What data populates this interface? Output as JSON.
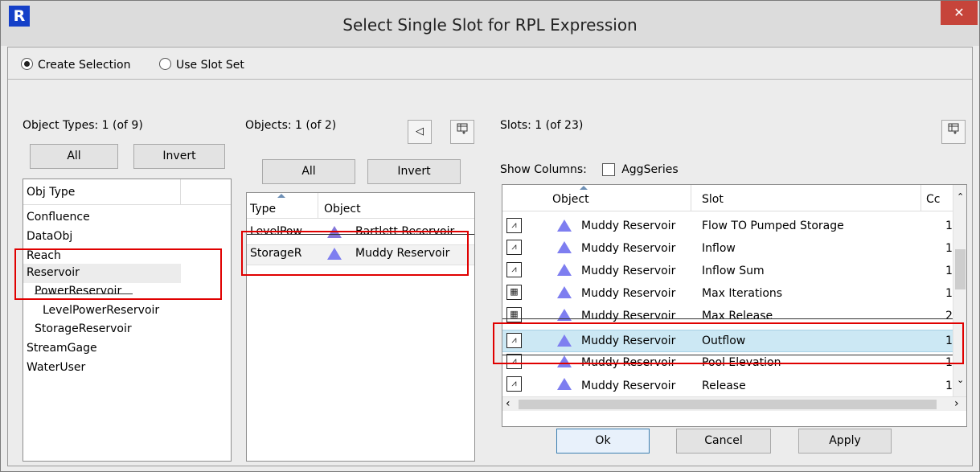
{
  "window": {
    "title": "Select Single Slot for RPL Expression",
    "app_icon": "R",
    "close_glyph": "✕"
  },
  "selection": {
    "create_label": "Create Selection",
    "use_slot_set_label": "Use Slot Set",
    "selected": "create"
  },
  "object_types": {
    "header": "Object Types: 1 (of 9)",
    "all_label": "All",
    "invert_label": "Invert",
    "column": "Obj Type",
    "items": [
      {
        "label": "Confluence"
      },
      {
        "label": "DataObj"
      },
      {
        "label": "Reach"
      },
      {
        "label": "Reservoir"
      },
      {
        "label": "PowerReservoir"
      },
      {
        "label": "LevelPowerReservoir"
      },
      {
        "label": "StorageReservoir"
      },
      {
        "label": "StreamGage"
      },
      {
        "label": "WaterUser"
      }
    ]
  },
  "objects": {
    "header": "Objects: 1 (of 2)",
    "all_label": "All",
    "invert_label": "Invert",
    "col_type": "Type",
    "col_object": "Object",
    "back_glyph": "◁",
    "columns_icon": "column-chooser-icon",
    "rows": [
      {
        "type": "LevelPow",
        "object": "Bartlett Reservoir"
      },
      {
        "type": "StorageR",
        "object": "Muddy Reservoir"
      }
    ]
  },
  "slots": {
    "header": "Slots: 1 (of 23)",
    "show_columns_label": "Show Columns:",
    "aggseries_label": "AggSeries",
    "col_object": "Object",
    "col_slot": "Slot",
    "col_c": "Cc",
    "columns_icon": "column-chooser-icon",
    "rows": [
      {
        "icon": "series-slot-icon",
        "object": "Muddy Reservoir",
        "slot": "Flow TO Pumped Storage",
        "c": "1"
      },
      {
        "icon": "multi-series-slot-icon",
        "object": "Muddy Reservoir",
        "slot": "Inflow",
        "c": "1"
      },
      {
        "icon": "series-slot-icon",
        "object": "Muddy Reservoir",
        "slot": "Inflow Sum",
        "c": "1"
      },
      {
        "icon": "table-slot-icon",
        "object": "Muddy Reservoir",
        "slot": "Max Iterations",
        "c": "1"
      },
      {
        "icon": "table-slot-icon",
        "object": "Muddy Reservoir",
        "slot": "Max Release",
        "c": "2"
      },
      {
        "icon": "series-slot-icon",
        "object": "Muddy Reservoir",
        "slot": "Outflow",
        "c": "1"
      },
      {
        "icon": "series-slot-icon",
        "object": "Muddy Reservoir",
        "slot": "Pool Elevation",
        "c": "1"
      },
      {
        "icon": "series-slot-icon",
        "object": "Muddy Reservoir",
        "slot": "Release",
        "c": "1"
      }
    ]
  },
  "footer": {
    "ok_label": "Ok",
    "cancel_label": "Cancel",
    "apply_label": "Apply"
  },
  "colors": {
    "selected_row": "#cce8f4",
    "highlight_box": "#e00000",
    "close_button": "#c6443a",
    "reservoir_icon": "#7e7ef0"
  }
}
